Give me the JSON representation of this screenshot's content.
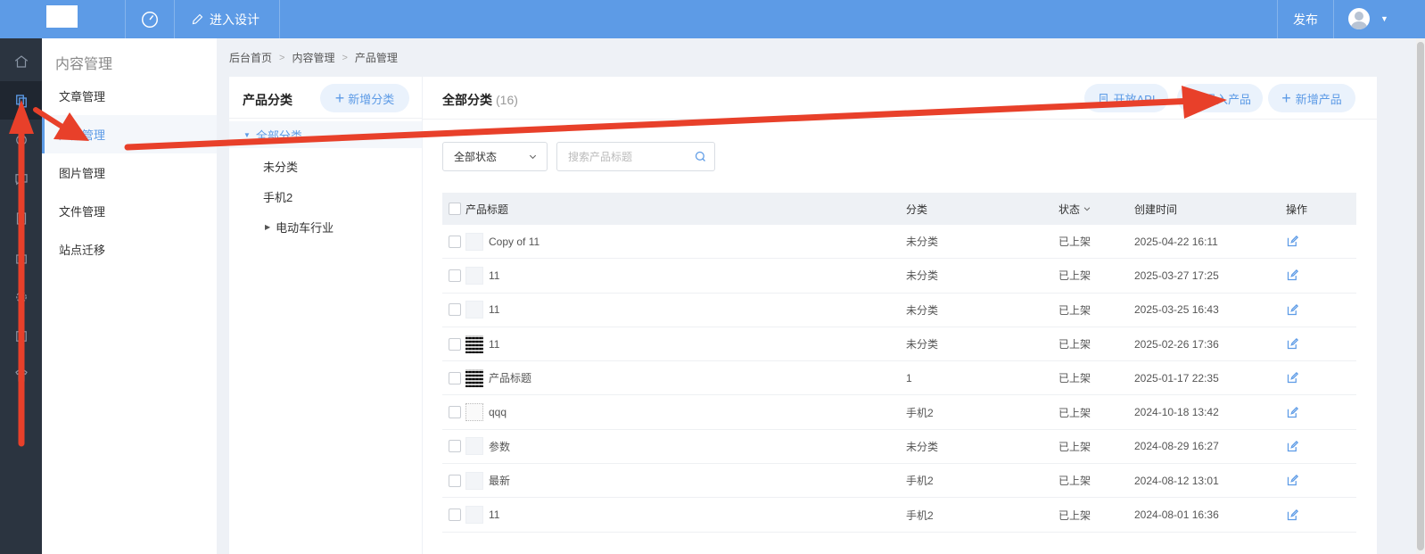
{
  "topbar": {
    "design_label": "进入设计",
    "publish_label": "发布"
  },
  "subnav": {
    "title": "内容管理",
    "items": [
      {
        "label": "文章管理"
      },
      {
        "label": "产品管理"
      },
      {
        "label": "图片管理"
      },
      {
        "label": "文件管理"
      },
      {
        "label": "站点迁移"
      }
    ]
  },
  "breadcrumb": [
    "后台首页",
    "内容管理",
    "产品管理"
  ],
  "category": {
    "title": "产品分类",
    "add_label": "新增分类",
    "nodes": [
      "全部分类",
      "未分类",
      "手机2",
      "电动车行业"
    ]
  },
  "main": {
    "title": "全部分类",
    "count": "(16)",
    "open_api_label": "开放API",
    "import_label": "导入产品",
    "add_label": "新增产品",
    "status_select": "全部状态",
    "search_placeholder": "搜索产品标题"
  },
  "table": {
    "headers": {
      "title": "产品标题",
      "category": "分类",
      "status": "状态",
      "created": "创建时间",
      "action": "操作"
    },
    "rows": [
      {
        "thumb": "blank",
        "title": "Copy of 11",
        "category": "未分类",
        "status": "已上架",
        "created": "2025-04-22 16:11"
      },
      {
        "thumb": "blank",
        "title": "11",
        "category": "未分类",
        "status": "已上架",
        "created": "2025-03-27 17:25"
      },
      {
        "thumb": "blank",
        "title": "11",
        "category": "未分类",
        "status": "已上架",
        "created": "2025-03-25 16:43"
      },
      {
        "thumb": "qr",
        "title": "11",
        "category": "未分类",
        "status": "已上架",
        "created": "2025-02-26 17:36"
      },
      {
        "thumb": "qr",
        "title": "产品标题",
        "category": "1",
        "status": "已上架",
        "created": "2025-01-17 22:35"
      },
      {
        "thumb": "dotted",
        "title": "qqq",
        "category": "手机2",
        "status": "已上架",
        "created": "2024-10-18 13:42"
      },
      {
        "thumb": "blank",
        "title": "参数",
        "category": "未分类",
        "status": "已上架",
        "created": "2024-08-29 16:27"
      },
      {
        "thumb": "blank",
        "title": "最新",
        "category": "手机2",
        "status": "已上架",
        "created": "2024-08-12 13:01"
      },
      {
        "thumb": "blank",
        "title": "11",
        "category": "手机2",
        "status": "已上架",
        "created": "2024-08-01 16:36"
      }
    ]
  },
  "colors": {
    "topbar": "#5d9be6",
    "rail": "#2b3440",
    "accent": "#5d9be6",
    "annotation": "#e8402a"
  },
  "icons": {
    "rail": [
      "home-icon",
      "copy-icon",
      "brush-icon",
      "chat-icon",
      "book-icon",
      "bag-icon",
      "gear-icon",
      "import-icon",
      "shirt-icon"
    ]
  }
}
